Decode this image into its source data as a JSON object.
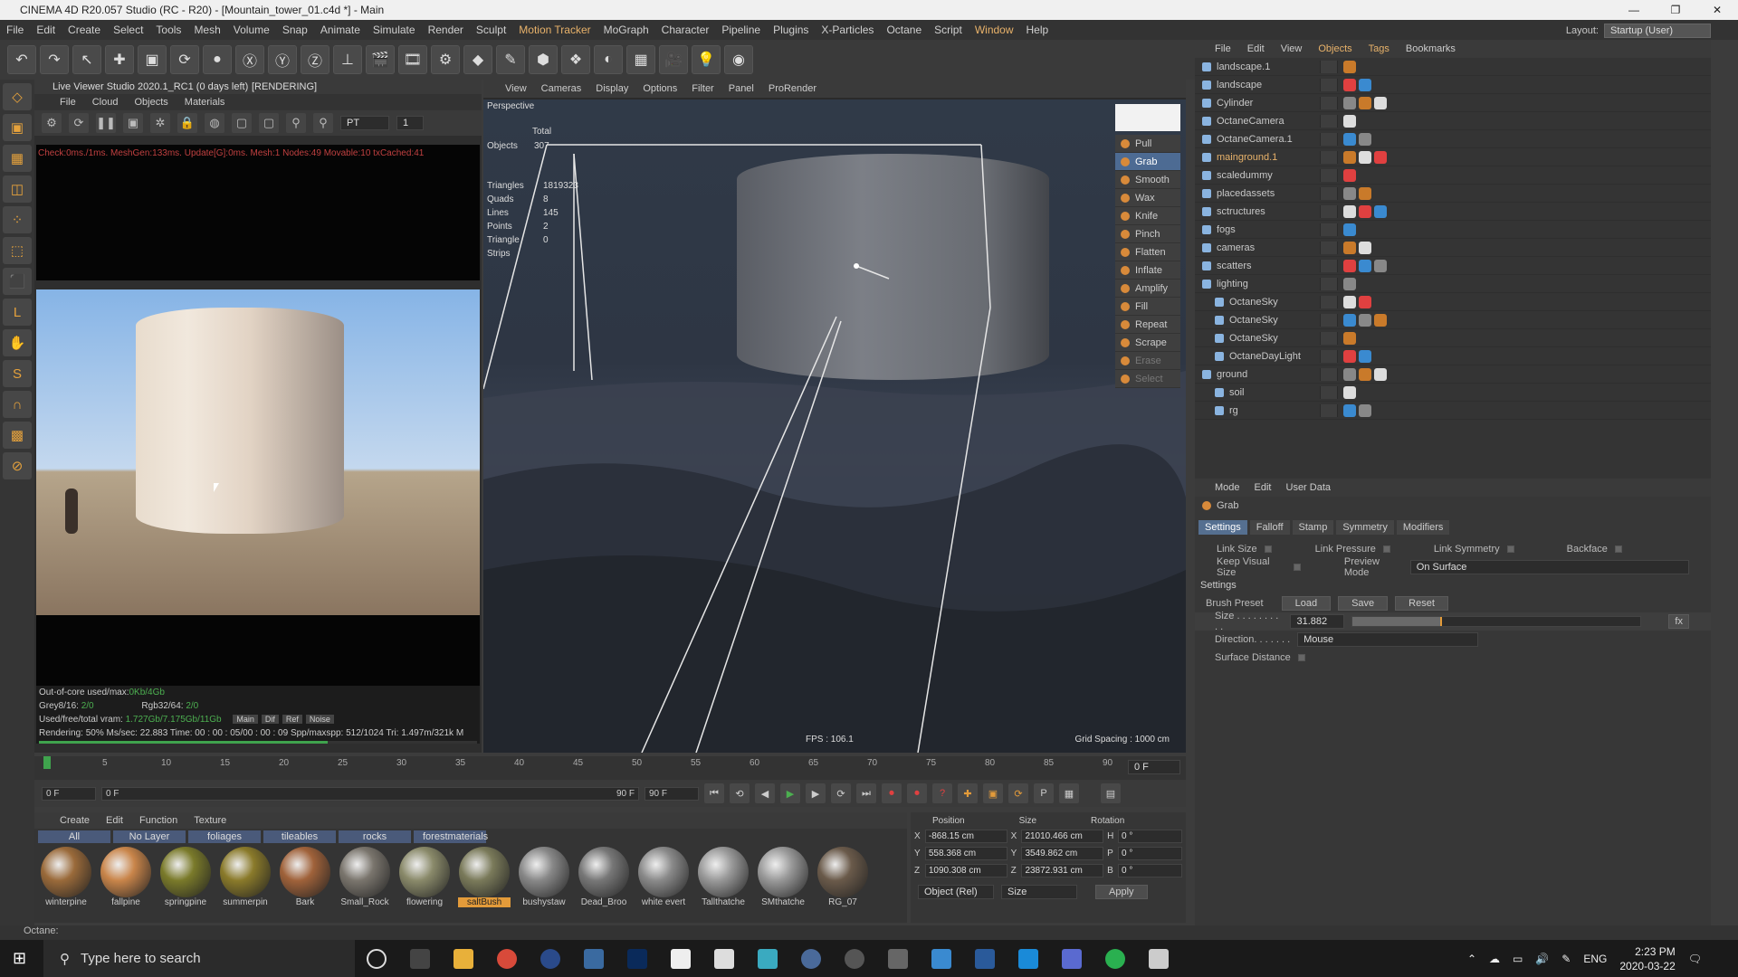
{
  "window": {
    "title": "CINEMA 4D R20.057 Studio (RC - R20) - [Mountain_tower_01.c4d *] - Main",
    "minimize": "—",
    "maximize": "❐",
    "close": "✕"
  },
  "menu": [
    "File",
    "Edit",
    "Create",
    "Select",
    "Tools",
    "Mesh",
    "Volume",
    "Snap",
    "Animate",
    "Simulate",
    "Render",
    "Sculpt",
    "Motion Tracker",
    "MoGraph",
    "Character",
    "Pipeline",
    "Plugins",
    "X-Particles",
    "Octane",
    "Script",
    "Window",
    "Help"
  ],
  "layout": {
    "label": "Layout:",
    "value": "Startup (User)"
  },
  "live_viewer": {
    "title": "Live Viewer Studio 2020.1_RC1 (0 days left)",
    "menu": [
      "File",
      "Cloud",
      "Objects",
      "Materials"
    ],
    "rendering": "[RENDERING]",
    "mode": "PT",
    "mode_num": "1",
    "red_stats": "Check:0ms./1ms. MeshGen:133ms. Update[G]:0ms. Mesh:1 Nodes:49 Movable:10 txCached:41",
    "ooc": "Out-of-core used/max:",
    "ooc_val": "0Kb/4Gb",
    "grey": "Grey8/16:",
    "grey_val": "2/0",
    "rgb": "Rgb32/64:",
    "rgb_val": "2/0",
    "vram": "Used/free/total vram:",
    "vram_val": "1.727Gb/7.175Gb/11Gb",
    "tabs": [
      "Main",
      "Dif",
      "Ref",
      "Noise"
    ],
    "rendering_line": "Rendering: 50%  Ms/sec: 22.883  Time: 00 : 00 : 05/00 : 00 : 09  Spp/maxspp: 512/1024  Tri: 1.497m/321k  M"
  },
  "viewport": {
    "menu": [
      "View",
      "Cameras",
      "Display",
      "Options",
      "Filter",
      "Panel",
      "ProRender"
    ],
    "name": "Perspective",
    "total": "Total",
    "objects_label": "Objects",
    "objects": "307",
    "stats": [
      {
        "label": "Triangles",
        "value": "1819323"
      },
      {
        "label": "Quads",
        "value": "8"
      },
      {
        "label": "Lines",
        "value": "145"
      },
      {
        "label": "Points",
        "value": "2"
      },
      {
        "label": "Triangle Strips",
        "value": "0"
      }
    ],
    "fps": "FPS : 106.1",
    "grid": "Grid Spacing : 1000 cm",
    "brushes": [
      "Pull",
      "Grab",
      "Smooth",
      "Wax",
      "Knife",
      "Pinch",
      "Flatten",
      "Inflate",
      "Amplify",
      "Fill",
      "Repeat",
      "Scrape",
      "Erase",
      "Select"
    ],
    "active_brush": "Grab"
  },
  "object_manager": {
    "menu": [
      "File",
      "Edit",
      "View",
      "Objects",
      "Tags",
      "Bookmarks"
    ],
    "items": [
      {
        "name": "landscape.1",
        "indent": 0
      },
      {
        "name": "landscape",
        "indent": 0
      },
      {
        "name": "Cylinder",
        "indent": 0
      },
      {
        "name": "OctaneCamera",
        "indent": 0
      },
      {
        "name": "OctaneCamera.1",
        "indent": 0
      },
      {
        "name": "mainground.1",
        "indent": 0
      },
      {
        "name": "scaledummy",
        "indent": 0
      },
      {
        "name": "placedassets",
        "indent": 0
      },
      {
        "name": "sctructures",
        "indent": 0
      },
      {
        "name": "fogs",
        "indent": 0
      },
      {
        "name": "cameras",
        "indent": 0
      },
      {
        "name": "scatters",
        "indent": 0
      },
      {
        "name": "lighting",
        "indent": 0
      },
      {
        "name": "OctaneSky",
        "indent": 1
      },
      {
        "name": "OctaneSky",
        "indent": 1
      },
      {
        "name": "OctaneSky",
        "indent": 1
      },
      {
        "name": "OctaneDayLight",
        "indent": 1
      },
      {
        "name": "ground",
        "indent": 0
      },
      {
        "name": "soil",
        "indent": 1
      },
      {
        "name": "rg",
        "indent": 1
      }
    ],
    "selected": "mainground.1"
  },
  "attributes": {
    "menu": [
      "Mode",
      "Edit",
      "User Data"
    ],
    "tool": "Grab",
    "tabs": [
      "Settings",
      "Falloff",
      "Stamp",
      "Symmetry",
      "Modifiers"
    ],
    "link_size": "Link Size",
    "link_pressure": "Link Pressure",
    "link_symmetry": "Link Symmetry",
    "backface": "Backface",
    "keep_visual": "Keep Visual Size",
    "preview_mode_label": "Preview Mode",
    "preview_mode": "On Surface",
    "settings": "Settings",
    "brush_preset": "Brush Preset",
    "load": "Load",
    "save": "Save",
    "reset": "Reset",
    "size_label": "Size . . . . . . . . . .",
    "size": "31.882",
    "size_fraction": 0.31,
    "fx": "fx",
    "direction_label": "Direction. . . . . . .",
    "direction": "Mouse",
    "surface_distance": "Surface Distance"
  },
  "timeline": {
    "ticks": [
      "0",
      "5",
      "10",
      "15",
      "20",
      "25",
      "30",
      "35",
      "40",
      "45",
      "50",
      "55",
      "60",
      "65",
      "70",
      "75",
      "80",
      "85",
      "90"
    ],
    "end": "0 F",
    "start_frame": "0 F",
    "min_frame": "0 F",
    "max_frame": "90 F",
    "total_frame": "90 F"
  },
  "materials": {
    "menu": [
      "Create",
      "Edit",
      "Function",
      "Texture"
    ],
    "tabs": [
      "All",
      "No Layer",
      "foliages",
      "tileables",
      "rocks",
      "forestmaterials"
    ],
    "items": [
      {
        "name": "winterpine",
        "color": "#9a6a3a"
      },
      {
        "name": "fallpine",
        "color": "#c9854a"
      },
      {
        "name": "springpine",
        "color": "#7a7a2a"
      },
      {
        "name": "summerpin",
        "color": "#8a7a2a"
      },
      {
        "name": "Bark",
        "color": "#a0623a"
      },
      {
        "name": "Small_Rock",
        "color": "#7a756d"
      },
      {
        "name": "flowering",
        "color": "#8a8a6a"
      },
      {
        "name": "saltBush",
        "color": "#7a7a5a"
      },
      {
        "name": "bushystaw",
        "color": "#888"
      },
      {
        "name": "Dead_Broo",
        "color": "#777"
      },
      {
        "name": "white evert",
        "color": "#8a8a8a"
      },
      {
        "name": "Tallthatche",
        "color": "#999"
      },
      {
        "name": "SMthatche",
        "color": "#999"
      },
      {
        "name": "RG_07",
        "color": "#6a5a4a"
      }
    ],
    "selected": "saltBush"
  },
  "coordinates": {
    "headers": [
      "Position",
      "Size",
      "Rotation"
    ],
    "rows": [
      {
        "a": "X",
        "pos": "-868.15 cm",
        "b": "X",
        "size": "21010.466 cm",
        "c": "H",
        "rot": "0 °"
      },
      {
        "a": "Y",
        "pos": "558.368 cm",
        "b": "Y",
        "size": "3549.862 cm",
        "c": "P",
        "rot": "0 °"
      },
      {
        "a": "Z",
        "pos": "1090.308 cm",
        "b": "Z",
        "size": "23872.931 cm",
        "c": "B",
        "rot": "0 °"
      }
    ],
    "mode": "Object (Rel)",
    "size_mode": "Size",
    "apply": "Apply"
  },
  "status": "Octane:",
  "taskbar": {
    "search": "Type here to search",
    "lang": "ENG",
    "time": "2:23 PM",
    "date": "2020-03-22"
  }
}
